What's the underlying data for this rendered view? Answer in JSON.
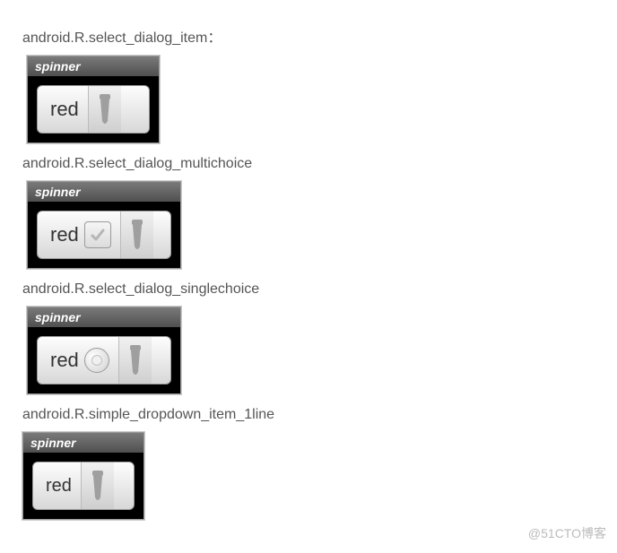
{
  "captions": {
    "item": "android.R.select_dialog_item：",
    "multichoice": "android.R.select_dialog_multichoice",
    "singlechoice": "android.R.select_dialog_singlechoice",
    "dropdown1line": "android.R.simple_dropdown_item_1line"
  },
  "spinner": {
    "title": "spinner",
    "value": "red"
  },
  "watermark": "@51CTO博客"
}
